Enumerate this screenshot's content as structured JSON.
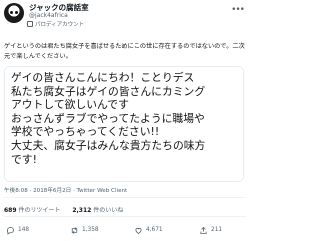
{
  "header": {
    "name": "ジャックの腐話室",
    "handle": "@jack4africa",
    "parody_label": "パロディアカウント"
  },
  "tweet": {
    "text": "ゲイというのは君たち腐女子を喜ばせるためにこの世に存在するのではないので。二次元で楽しんでください。"
  },
  "quoted": {
    "text": "ゲイの皆さんこんにちわ！ことりデス\n私たち腐女子はゲイの皆さんにカミング\nアウトして欲しいんです\nおっさんずラブでやってたように職場や\n学校でやっちゃってください!!\n大丈夫、腐女子はみんな貴方たちの味方\nです!"
  },
  "meta": {
    "time_date_client": "午後8:08 · 2018年6月2日 · Twitter Web Client"
  },
  "stats": {
    "retweets_count": "689",
    "retweets_label": "件のリツイート",
    "likes_count": "2,312",
    "likes_label": "件のいいね"
  },
  "actions": {
    "reply_count": "148",
    "retweet_count": "1,358",
    "like_count": "4,671",
    "share_count": "211"
  }
}
